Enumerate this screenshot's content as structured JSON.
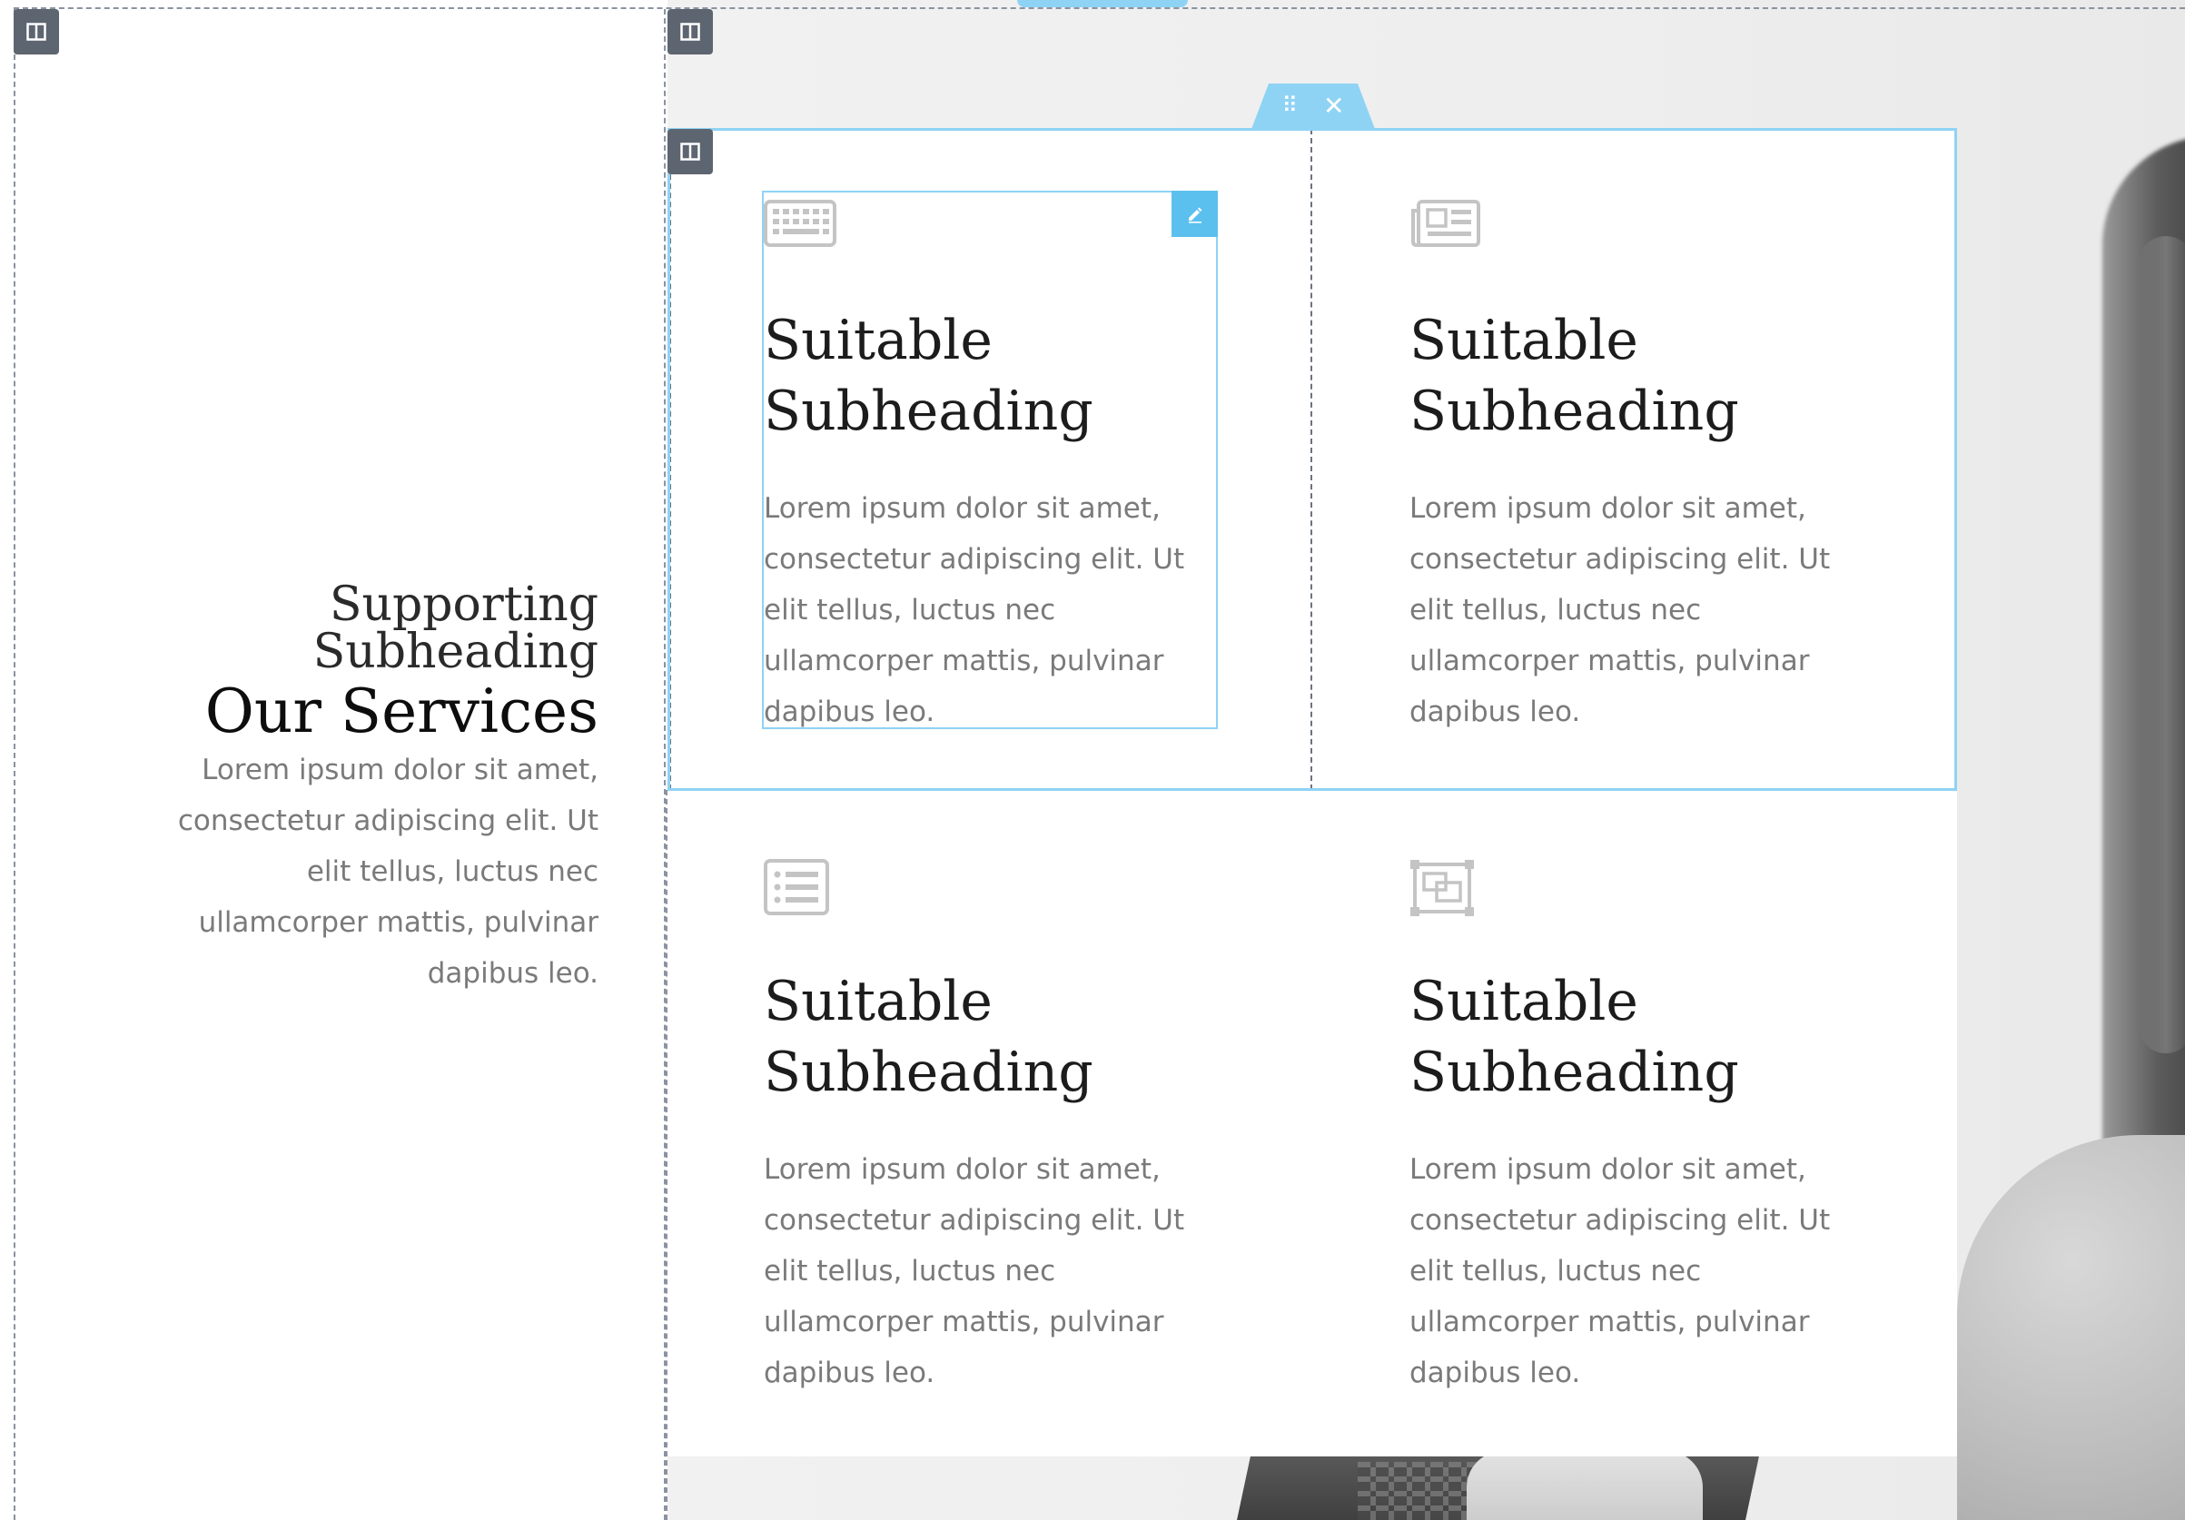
{
  "left": {
    "supporting_subheading": "Supporting Subheading",
    "title": "Our Services",
    "description": "Lorem ipsum dolor sit amet, consectetur adipiscing elit. Ut elit tellus, luctus nec ullamcorper mattis, pulvinar dapibus leo."
  },
  "services": [
    {
      "icon": "keyboard-icon",
      "heading": "Suitable Subheading",
      "text": "Lorem ipsum dolor sit amet, consectetur adipiscing elit. Ut elit tellus, luctus nec ullamcorper mattis, pulvinar dapibus leo."
    },
    {
      "icon": "newspaper-icon",
      "heading": "Suitable Subheading",
      "text": "Lorem ipsum dolor sit amet, consectetur adipiscing elit. Ut elit tellus, luctus nec ullamcorper mattis, pulvinar dapibus leo."
    },
    {
      "icon": "list-alt-icon",
      "heading": "Suitable Subheading",
      "text": "Lorem ipsum dolor sit amet, consectetur adipiscing elit. Ut elit tellus, luctus nec ullamcorper mattis, pulvinar dapibus leo."
    },
    {
      "icon": "object-ungroup-icon",
      "heading": "Suitable Subheading",
      "text": "Lorem ipsum dolor sit amet, consectetur adipiscing elit. Ut elit tellus, luctus nec ullamcorper mattis, pulvinar dapibus leo."
    }
  ],
  "editor": {
    "accent_color": "#8fd3f4",
    "handle_color": "#5d6570",
    "edit_button_color": "#5bc0ee",
    "drag_icon": "drag-handle-icon",
    "close_icon": "close-icon",
    "edit_icon": "pencil-icon",
    "column_icon": "column-layout-icon"
  }
}
